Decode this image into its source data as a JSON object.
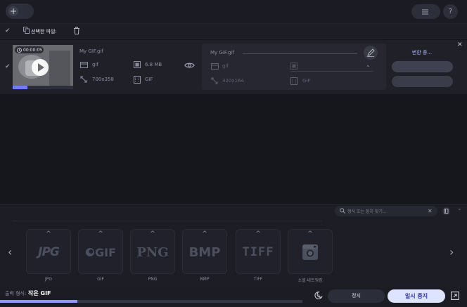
{
  "toolbar": {
    "add_files_label": "",
    "menu_label": "",
    "help_label": "?"
  },
  "selection": {
    "label": "선택한 파일:",
    "count": ""
  },
  "file": {
    "duration": "00:00:05",
    "progress": 0.24,
    "source": {
      "name": "My GIF.gif",
      "format": "gif",
      "size": "6.8 MB",
      "resolution": "700x358",
      "codec": "GIF"
    },
    "target": {
      "name": "My GIF.gif",
      "format": "gif",
      "quality": "",
      "resolution": "320x164",
      "codec": "GIF"
    },
    "status": "변환 중...",
    "button_a": "",
    "button_b": ""
  },
  "tabs": [
    "",
    "",
    "",
    "",
    ""
  ],
  "search": {
    "placeholder": "형식 또는 장치 찾기..."
  },
  "formats": [
    {
      "label": "JPG",
      "logo": "JPG"
    },
    {
      "label": "GIF",
      "logo": "GIF"
    },
    {
      "label": "PNG",
      "logo": "PNG"
    },
    {
      "label": "BMP",
      "logo": "BMP"
    },
    {
      "label": "TIFF",
      "logo": "TIFF"
    },
    {
      "label": "소셜 네트워킹",
      "logo": "camera-icon"
    }
  ],
  "footer": {
    "output_label": "출력 형식:",
    "output_value": "작은 GIF",
    "overall_progress": 0.165,
    "stop_label": "정지",
    "pause_label": "일시 중지"
  },
  "colors": {
    "accent": "#8f99ff",
    "pause_bg": "#dee3ff",
    "pause_text": "#2c34a8"
  }
}
